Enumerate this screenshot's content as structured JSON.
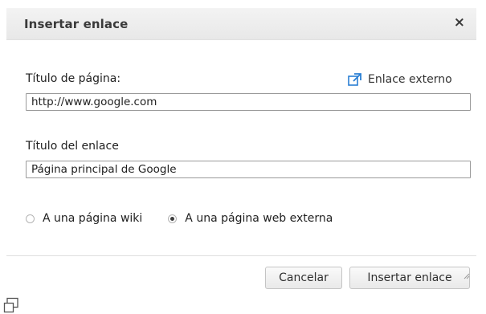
{
  "dialog": {
    "title": "Insertar enlace",
    "close_label": "×"
  },
  "form": {
    "page_title_label": "Título de página:",
    "page_title_value": "http://www.google.com",
    "external_link_label": "Enlace externo",
    "external_link_icon": "external-link-icon",
    "link_title_label": "Título del enlace",
    "link_title_value": "Página principal de Google",
    "radio_options": [
      {
        "label": "A una página wiki",
        "checked": false
      },
      {
        "label": "A una página web externa",
        "checked": true
      }
    ]
  },
  "buttons": {
    "cancel": "Cancelar",
    "insert": "Insertar enlace"
  },
  "colors": {
    "titlebar": "#ececec",
    "link_icon_blue": "#2a7fd4"
  }
}
